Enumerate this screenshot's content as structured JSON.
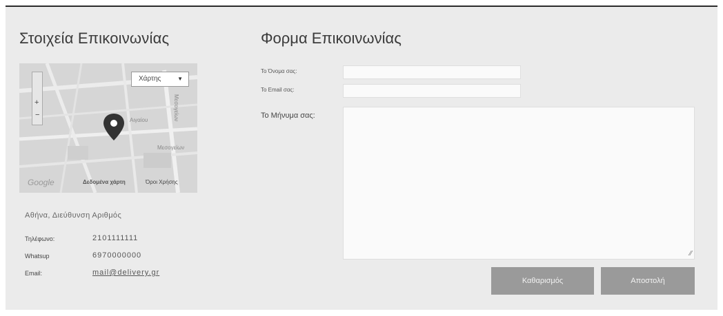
{
  "contact_info": {
    "title": "Στοιχεία Επικοινωνίας",
    "map": {
      "type_selector": "Χάρτης",
      "logo": "Google",
      "data_label": "Δεδομένα χάρτη",
      "terms_label": "Όροι Χρήσης",
      "street_labels": [
        "Αιγαίου",
        "Μεσογείων",
        "Μεσογείων"
      ]
    },
    "address": "Αθήνα, Διεύθυνση Αριθμός",
    "rows": [
      {
        "label": "Τηλέφωνο:",
        "value": "2101111111"
      },
      {
        "label": "Whatsup",
        "value": "6970000000"
      },
      {
        "label": "Email:",
        "value": "mail@delivery.gr"
      }
    ]
  },
  "contact_form": {
    "title": "Φορμα Επικοινωνίας",
    "name_label": "Το Όνομα σας:",
    "email_label": "Το Email σας:",
    "message_label": "Το Μήνυμα σας:",
    "clear_button": "Καθαρισμός",
    "send_button": "Αποστολή"
  },
  "colors": {
    "background": "#ebebeb",
    "button": "#9a9a9a",
    "map_marker": "#333333"
  }
}
